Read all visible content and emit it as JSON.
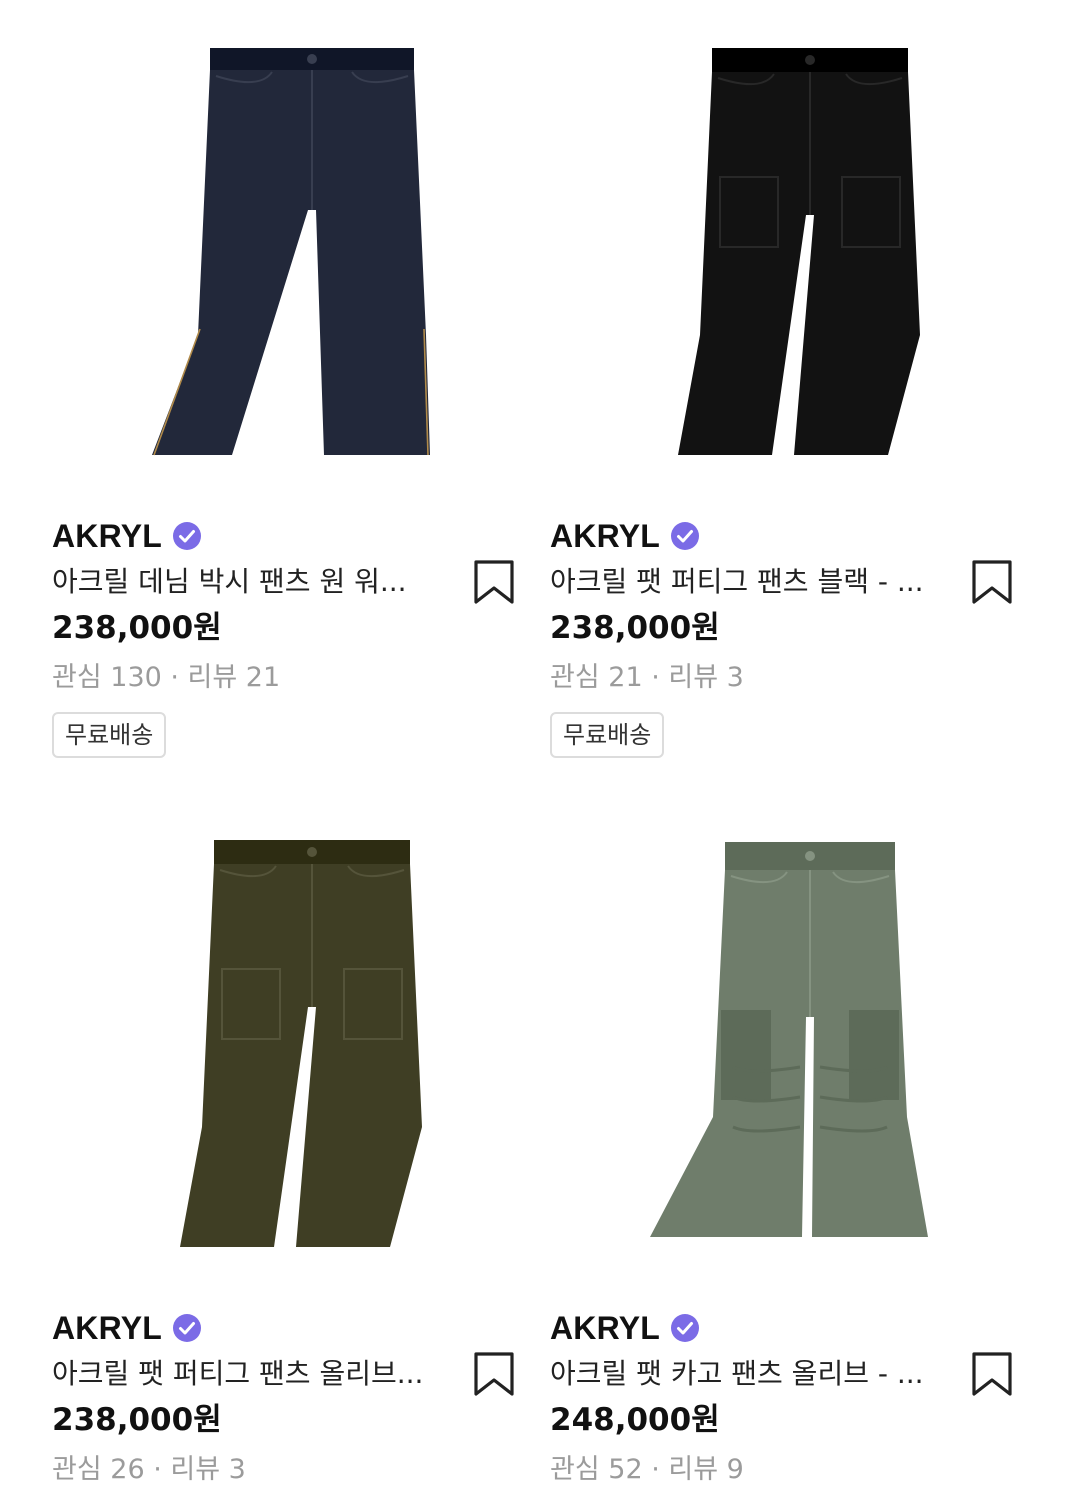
{
  "products": [
    {
      "brand": "AKRYL",
      "name": "아크릴 데님 박시 팬츠 원 워...",
      "price": "238,000원",
      "stats": "관심 130 · 리뷰 21",
      "badge": "무료배송",
      "image_color": "#22283a",
      "image_style": "denim",
      "image_label": "denim-pants-image"
    },
    {
      "brand": "AKRYL",
      "name": "아크릴 팻 퍼티그 팬츠 블랙 - ...",
      "price": "238,000원",
      "stats": "관심 21 · 리뷰 3",
      "badge": "무료배송",
      "image_color": "#121212",
      "image_style": "fatigue",
      "image_label": "black-fatigue-pants-image"
    },
    {
      "brand": "AKRYL",
      "name": "아크릴 팻 퍼티그 팬츠 올리브...",
      "price": "238,000원",
      "stats": "관심 26 · 리뷰 3",
      "badge": "",
      "image_color": "#3f3e24",
      "image_style": "fatigue",
      "image_label": "olive-fatigue-pants-image"
    },
    {
      "brand": "AKRYL",
      "name": "아크릴 팻 카고 팬츠 올리브 - ...",
      "price": "248,000원",
      "stats": "관심 52 · 리뷰 9",
      "badge": "",
      "image_color": "#6f7d6b",
      "image_style": "cargo",
      "image_label": "olive-cargo-pants-image"
    }
  ],
  "icons": {
    "verified": "verified-badge-icon",
    "bookmark": "bookmark-icon",
    "verified_color": "#7b6be6"
  }
}
